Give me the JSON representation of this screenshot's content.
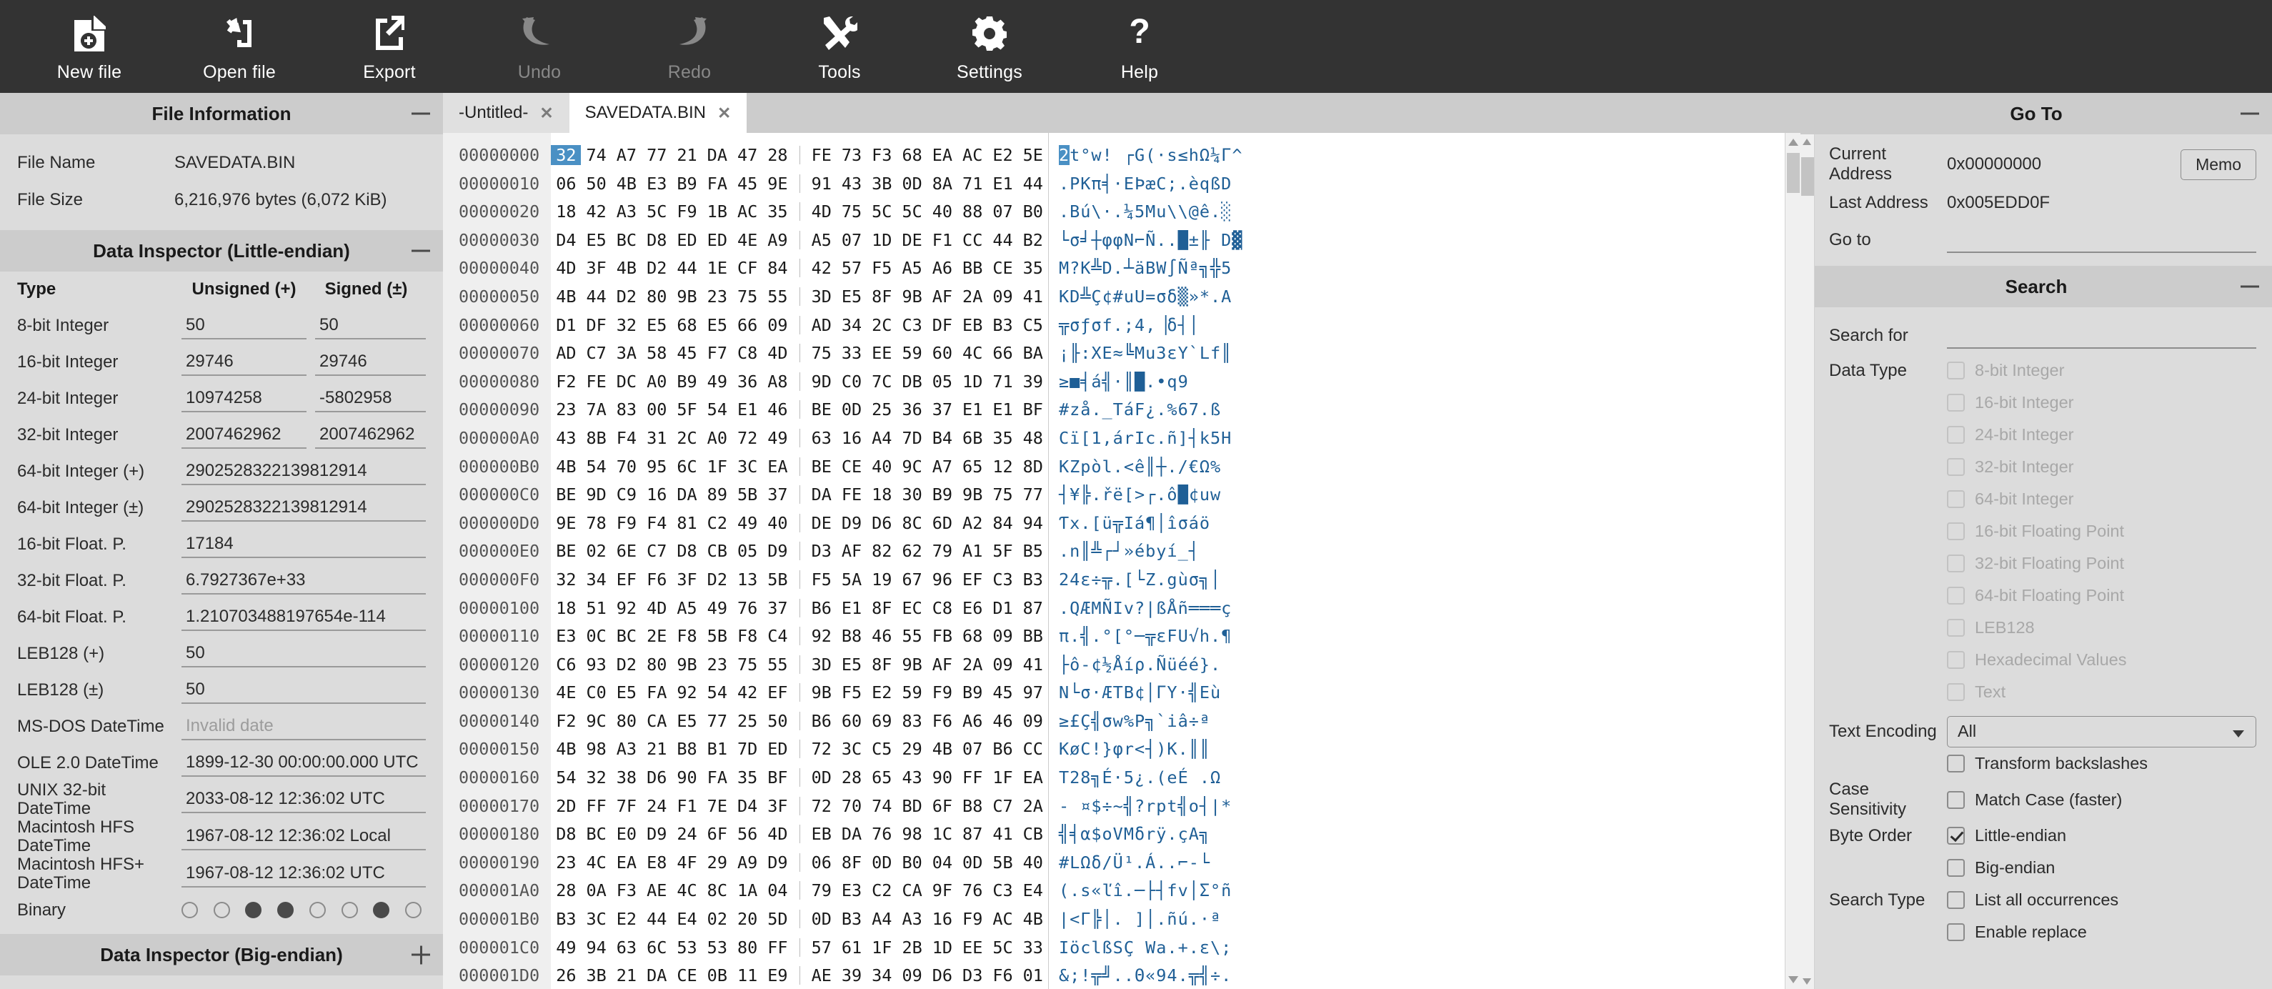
{
  "toolbar": {
    "buttons": [
      {
        "label": "New file",
        "icon": "new-file-icon",
        "disabled": false
      },
      {
        "label": "Open file",
        "icon": "open-file-icon",
        "disabled": false
      },
      {
        "label": "Export",
        "icon": "export-icon",
        "disabled": false
      },
      {
        "label": "Undo",
        "icon": "undo-icon",
        "disabled": true
      },
      {
        "label": "Redo",
        "icon": "redo-icon",
        "disabled": true
      },
      {
        "label": "Tools",
        "icon": "tools-icon",
        "disabled": false
      },
      {
        "label": "Settings",
        "icon": "gear-icon",
        "disabled": false
      },
      {
        "label": "Help",
        "icon": "help-icon",
        "disabled": false
      }
    ]
  },
  "file_information": {
    "title": "File Information",
    "rows": [
      {
        "key": "File Name",
        "value": "SAVEDATA.BIN"
      },
      {
        "key": "File Size",
        "value": "6,216,976 bytes (6,072 KiB)"
      }
    ]
  },
  "data_inspector_le": {
    "title": "Data Inspector (Little-endian)",
    "headers": {
      "type": "Type",
      "unsigned": "Unsigned (+)",
      "signed": "Signed (±)"
    },
    "rows": [
      {
        "type": "8-bit Integer",
        "unsigned": "50",
        "signed": "50"
      },
      {
        "type": "16-bit Integer",
        "unsigned": "29746",
        "signed": "29746"
      },
      {
        "type": "24-bit Integer",
        "unsigned": "10974258",
        "signed": "-5802958"
      },
      {
        "type": "32-bit Integer",
        "unsigned": "2007462962",
        "signed": "2007462962"
      },
      {
        "type": "64-bit Integer (+)",
        "unsigned": "2902528322139812914",
        "signed": ""
      },
      {
        "type": "64-bit Integer (±)",
        "unsigned": "2902528322139812914",
        "signed": ""
      },
      {
        "type": "16-bit Float. P.",
        "unsigned": "17184",
        "signed": ""
      },
      {
        "type": "32-bit Float. P.",
        "unsigned": "6.7927367e+33",
        "signed": ""
      },
      {
        "type": "64-bit Float. P.",
        "unsigned": "1.210703488197654e-114",
        "signed": ""
      },
      {
        "type": "LEB128 (+)",
        "unsigned": "50",
        "signed": ""
      },
      {
        "type": "LEB128 (±)",
        "unsigned": "50",
        "signed": ""
      },
      {
        "type": "MS-DOS DateTime",
        "unsigned": "Invalid date",
        "signed": "",
        "placeholder": true
      },
      {
        "type": "OLE 2.0 DateTime",
        "unsigned": "1899-12-30 00:00:00.000 UTC",
        "signed": ""
      },
      {
        "type": "UNIX 32-bit DateTime",
        "unsigned": "2033-08-12 12:36:02 UTC",
        "signed": ""
      },
      {
        "type": "Macintosh HFS DateTime",
        "unsigned": "1967-08-12 12:36:02 Local",
        "signed": ""
      },
      {
        "type": "Macintosh HFS+ DateTime",
        "unsigned": "1967-08-12 12:36:02 UTC",
        "signed": ""
      }
    ],
    "binary_label": "Binary",
    "binary_bits": [
      0,
      0,
      1,
      1,
      0,
      0,
      1,
      0
    ]
  },
  "data_inspector_be": {
    "title": "Data Inspector (Big-endian)"
  },
  "tabs": [
    {
      "label": "-Untitled-",
      "active": false,
      "close": "✕"
    },
    {
      "label": "SAVEDATA.BIN",
      "active": true,
      "close": "✕"
    }
  ],
  "hex": {
    "selected_index": 0,
    "rows": [
      {
        "addr": "00000000",
        "bytes": [
          "32",
          "74",
          "A7",
          "77",
          "21",
          "DA",
          "47",
          "28",
          "FE",
          "73",
          "F3",
          "68",
          "EA",
          "AC",
          "E2",
          "5E"
        ],
        "ascii": "2t°w! ┌G(·s≤hΩ¼Γ^"
      },
      {
        "addr": "00000010",
        "bytes": [
          "06",
          "50",
          "4B",
          "E3",
          "B9",
          "FA",
          "45",
          "9E",
          "91",
          "43",
          "3B",
          "0D",
          "8A",
          "71",
          "E1",
          "44"
        ],
        "ascii": ".PKπ╡·EÞæC;.èqßD"
      },
      {
        "addr": "00000020",
        "bytes": [
          "18",
          "42",
          "A3",
          "5C",
          "F9",
          "1B",
          "AC",
          "35",
          "4D",
          "75",
          "5C",
          "5C",
          "40",
          "88",
          "07",
          "B0"
        ],
        "ascii": ".Bú\\·.¼5Mu\\\\@ê.░"
      },
      {
        "addr": "00000030",
        "bytes": [
          "D4",
          "E5",
          "BC",
          "D8",
          "ED",
          "ED",
          "4E",
          "A9",
          "A5",
          "07",
          "1D",
          "DE",
          "F1",
          "CC",
          "44",
          "B2"
        ],
        "ascii": "└σ╛┼φφN⌐Ñ..█±╟ D▓"
      },
      {
        "addr": "00000040",
        "bytes": [
          "4D",
          "3F",
          "4B",
          "D2",
          "44",
          "1E",
          "CF",
          "84",
          "42",
          "57",
          "F5",
          "A5",
          "A6",
          "BB",
          "CE",
          "35"
        ],
        "ascii": "M?K╩D.┴äBW∫Ñª╗╬5"
      },
      {
        "addr": "00000050",
        "bytes": [
          "4B",
          "44",
          "D2",
          "80",
          "9B",
          "23",
          "75",
          "55",
          "3D",
          "E5",
          "8F",
          "9B",
          "AF",
          "2A",
          "09",
          "41"
        ],
        "ascii": "KD╩Ç¢#uU=σδ▒»*.A"
      },
      {
        "addr": "00000060",
        "bytes": [
          "D1",
          "DF",
          "32",
          "E5",
          "68",
          "E5",
          "66",
          "09",
          "AD",
          "34",
          "2C",
          "C3",
          "DF",
          "EB",
          "B3",
          "C5"
        ],
        "ascii": "╦σƒσf.;4,▕δ┤│"
      },
      {
        "addr": "00000070",
        "bytes": [
          "AD",
          "C7",
          "3A",
          "58",
          "45",
          "F7",
          "C8",
          "4D",
          "75",
          "33",
          "EE",
          "59",
          "60",
          "4C",
          "66",
          "BA"
        ],
        "ascii": "¡╟:XE≈╚Mu3εY`Lf║"
      },
      {
        "addr": "00000080",
        "bytes": [
          "F2",
          "FE",
          "DC",
          "A0",
          "B9",
          "49",
          "36",
          "A8",
          "9D",
          "C0",
          "7C",
          "DB",
          "05",
          "1D",
          "71",
          "39"
        ],
        "ascii": "≥■╡á╣·║█.•q9"
      },
      {
        "addr": "00000090",
        "bytes": [
          "23",
          "7A",
          "83",
          "00",
          "5F",
          "54",
          "E1",
          "46",
          "BE",
          "0D",
          "25",
          "36",
          "37",
          "E1",
          "E1",
          "BF"
        ],
        "ascii": "#zå._TáF¿.%67.ß"
      },
      {
        "addr": "000000A0",
        "bytes": [
          "43",
          "8B",
          "F4",
          "31",
          "2C",
          "A0",
          "72",
          "49",
          "63",
          "16",
          "A4",
          "7D",
          "B4",
          "6B",
          "35",
          "48"
        ],
        "ascii": "Cï[1,árIc.ñ]┤k5H"
      },
      {
        "addr": "000000B0",
        "bytes": [
          "4B",
          "54",
          "70",
          "95",
          "6C",
          "1F",
          "3C",
          "EA",
          "BE",
          "CE",
          "40",
          "9C",
          "A7",
          "65",
          "12",
          "8D"
        ],
        "ascii": "KZpòl.<ê║┼./€Ω%"
      },
      {
        "addr": "000000C0",
        "bytes": [
          "BE",
          "9D",
          "C9",
          "16",
          "DA",
          "89",
          "5B",
          "37",
          "DA",
          "FE",
          "18",
          "30",
          "B9",
          "9B",
          "75",
          "77"
        ],
        "ascii": "┤¥╠.řë[>┌.ô█¢uw"
      },
      {
        "addr": "000000D0",
        "bytes": [
          "9E",
          "78",
          "F9",
          "F4",
          "81",
          "C2",
          "49",
          "40",
          "DE",
          "D9",
          "D6",
          "8C",
          "6D",
          "A2",
          "84",
          "94"
        ],
        "ascii": "Ƭx.[ü╦Iá¶│îσáö"
      },
      {
        "addr": "000000E0",
        "bytes": [
          "BE",
          "02",
          "6E",
          "C7",
          "D8",
          "CB",
          "05",
          "D9",
          "D3",
          "AF",
          "82",
          "62",
          "79",
          "A1",
          "5F",
          "B5"
        ],
        "ascii": ".n║╩┌┘»ébyí_┤"
      },
      {
        "addr": "000000F0",
        "bytes": [
          "32",
          "34",
          "EF",
          "F6",
          "3F",
          "D2",
          "13",
          "5B",
          "F5",
          "5A",
          "19",
          "67",
          "96",
          "EF",
          "C3",
          "B3"
        ],
        "ascii": "24ε÷╦.[└Z.gùσ╗│"
      },
      {
        "addr": "00000100",
        "bytes": [
          "18",
          "51",
          "92",
          "4D",
          "A5",
          "49",
          "76",
          "37",
          "B6",
          "E1",
          "8F",
          "EC",
          "C8",
          "E6",
          "D1",
          "87"
        ],
        "ascii": ".QÆMÑIv?|ßÅñ═══ç"
      },
      {
        "addr": "00000110",
        "bytes": [
          "E3",
          "0C",
          "BC",
          "2E",
          "F8",
          "5B",
          "F8",
          "C4",
          "92",
          "B8",
          "46",
          "55",
          "FB",
          "68",
          "09",
          "BB"
        ],
        "ascii": "π.╣.°[°─╦εFU√h.¶"
      },
      {
        "addr": "00000120",
        "bytes": [
          "C6",
          "93",
          "D2",
          "80",
          "9B",
          "23",
          "75",
          "55",
          "3D",
          "E5",
          "8F",
          "9B",
          "AF",
          "2A",
          "09",
          "41"
        ],
        "ascii": "├ô-¢½Åíρ.Ñüéé}."
      },
      {
        "addr": "00000130",
        "bytes": [
          "4E",
          "C0",
          "E5",
          "FA",
          "92",
          "54",
          "42",
          "EF",
          "9B",
          "F5",
          "E2",
          "59",
          "F9",
          "B9",
          "45",
          "97"
        ],
        "ascii": "N└σ·ÆTB¢│ΓY·╣Eù"
      },
      {
        "addr": "00000140",
        "bytes": [
          "F2",
          "9C",
          "80",
          "CA",
          "E5",
          "77",
          "25",
          "50",
          "B6",
          "60",
          "69",
          "83",
          "F6",
          "A6",
          "46",
          "09"
        ],
        "ascii": "≥£Ç╣σw%P╗`iâ÷ª"
      },
      {
        "addr": "00000150",
        "bytes": [
          "4B",
          "98",
          "A3",
          "21",
          "B8",
          "B1",
          "7D",
          "ED",
          "72",
          "3C",
          "C5",
          "29",
          "4B",
          "07",
          "B6",
          "CC"
        ],
        "ascii": "KøC!}φr<┤)K.║║"
      },
      {
        "addr": "00000160",
        "bytes": [
          "54",
          "32",
          "38",
          "D6",
          "90",
          "FA",
          "35",
          "BF",
          "0D",
          "28",
          "65",
          "43",
          "90",
          "FF",
          "1F",
          "EA"
        ],
        "ascii": "T28╗É·5¿.(eÉ .Ω"
      },
      {
        "addr": "00000170",
        "bytes": [
          "2D",
          "FF",
          "7F",
          "24",
          "F1",
          "7E",
          "D4",
          "3F",
          "72",
          "70",
          "74",
          "BD",
          "6F",
          "B8",
          "C7",
          "2A"
        ],
        "ascii": "- ¤$÷~╣?rpt╣o┤|*"
      },
      {
        "addr": "00000180",
        "bytes": [
          "D8",
          "BC",
          "E0",
          "D9",
          "24",
          "6F",
          "56",
          "4D",
          "EB",
          "DA",
          "76",
          "98",
          "1C",
          "87",
          "41",
          "CB"
        ],
        "ascii": "╣╡α$oVMδrÿ.çA╗"
      },
      {
        "addr": "00000190",
        "bytes": [
          "23",
          "4C",
          "EA",
          "E8",
          "4F",
          "29",
          "A9",
          "D9",
          "06",
          "8F",
          "0D",
          "B0",
          "04",
          "0D",
          "5B",
          "40"
        ],
        "ascii": "#LΩδ/Ü¹.Á..⌐-└"
      },
      {
        "addr": "000001A0",
        "bytes": [
          "28",
          "0A",
          "F3",
          "AE",
          "4C",
          "8C",
          "1A",
          "04",
          "79",
          "E3",
          "C2",
          "CA",
          "9F",
          "76",
          "C3",
          "E4"
        ],
        "ascii": "(.s«ľî.─├┤fv│Σ°ñ"
      },
      {
        "addr": "000001B0",
        "bytes": [
          "B3",
          "3C",
          "E2",
          "44",
          "E4",
          "02",
          "20",
          "5D",
          "0D",
          "B3",
          "A4",
          "A3",
          "16",
          "F9",
          "AC",
          "4B"
        ],
        "ascii": "|<Г╠│. ]│.ñú.·ª"
      },
      {
        "addr": "000001C0",
        "bytes": [
          "49",
          "94",
          "63",
          "6C",
          "53",
          "53",
          "80",
          "FF",
          "57",
          "61",
          "1F",
          "2B",
          "1D",
          "EE",
          "5C",
          "33"
        ],
        "ascii": "IöclßSÇ Wa.+.ε\\;"
      },
      {
        "addr": "000001D0",
        "bytes": [
          "26",
          "3B",
          "21",
          "DA",
          "CE",
          "0B",
          "11",
          "E9",
          "AE",
          "39",
          "34",
          "09",
          "D6",
          "D3",
          "F6",
          "01"
        ],
        "ascii": "&;!╦╝..Θ«94.╦╣÷."
      }
    ]
  },
  "go_to": {
    "title": "Go To",
    "current_address_label": "Current Address",
    "current_address_value": "0x00000000",
    "last_address_label": "Last Address",
    "last_address_value": "0x005EDD0F",
    "go_to_label": "Go to",
    "go_to_value": "",
    "memo_label": "Memo"
  },
  "search": {
    "title": "Search",
    "search_for_label": "Search for",
    "search_for_value": "",
    "data_type_label": "Data Type",
    "data_types": [
      {
        "label": "8-bit Integer",
        "checked": false,
        "disabled": true
      },
      {
        "label": "16-bit Integer",
        "checked": false,
        "disabled": true
      },
      {
        "label": "24-bit Integer",
        "checked": false,
        "disabled": true
      },
      {
        "label": "32-bit Integer",
        "checked": false,
        "disabled": true
      },
      {
        "label": "64-bit Integer",
        "checked": false,
        "disabled": true
      },
      {
        "label": "16-bit Floating Point",
        "checked": false,
        "disabled": true
      },
      {
        "label": "32-bit Floating Point",
        "checked": false,
        "disabled": true
      },
      {
        "label": "64-bit Floating Point",
        "checked": false,
        "disabled": true
      },
      {
        "label": "LEB128",
        "checked": false,
        "disabled": true
      },
      {
        "label": "Hexadecimal Values",
        "checked": false,
        "disabled": true
      },
      {
        "label": "Text",
        "checked": false,
        "disabled": true
      }
    ],
    "text_encoding_label": "Text Encoding",
    "text_encoding_value": "All",
    "transform_backslashes": {
      "label": "Transform backslashes",
      "checked": false
    },
    "case_sensitivity_label": "Case Sensitivity",
    "match_case": {
      "label": "Match Case (faster)",
      "checked": false
    },
    "byte_order_label": "Byte Order",
    "little_endian": {
      "label": "Little-endian",
      "checked": true
    },
    "big_endian": {
      "label": "Big-endian",
      "checked": false
    },
    "search_type_label": "Search Type",
    "list_all": {
      "label": "List all occurrences",
      "checked": false
    },
    "enable_replace": {
      "label": "Enable replace",
      "checked": false
    }
  }
}
